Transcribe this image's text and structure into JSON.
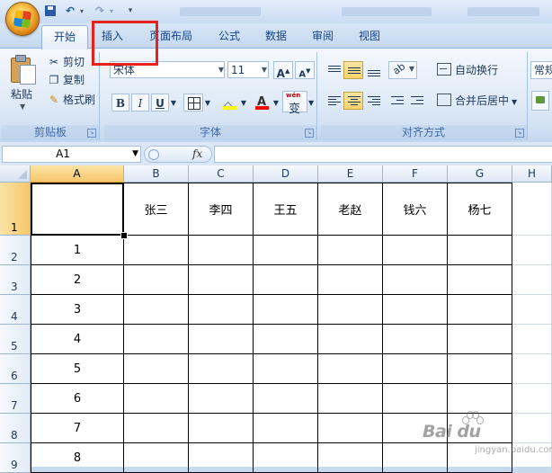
{
  "quick_access": {
    "undo_glyph": "↶",
    "redo_glyph": "↷",
    "dropdown_glyph": "▾",
    "customize_glyph": "▾"
  },
  "tabs": [
    "开始",
    "插入",
    "页面布局",
    "公式",
    "数据",
    "审阅",
    "视图"
  ],
  "ribbon": {
    "clipboard": {
      "paste_label": "粘贴",
      "cut_label": "剪切",
      "copy_label": "复制",
      "format_painter_label": "格式刷",
      "group_label": "剪贴板",
      "icons": {
        "cut": "scissors-icon",
        "copy": "copy-icon",
        "painter": "format-painter-icon"
      }
    },
    "font": {
      "font_name": "宋体",
      "font_size": "11",
      "grow_label": "A",
      "shrink_label": "A",
      "bold": "B",
      "italic": "I",
      "underline": "U",
      "font_color_letter": "A",
      "phonetic_small": "wén",
      "phonetic_char": "变",
      "fill_color": "#ffff00",
      "font_color": "#ff0000",
      "group_label": "字体"
    },
    "alignment": {
      "orientation_glyph": "ab",
      "wrap_text_label": "自动换行",
      "merge_center_label": "合并后居中",
      "group_label": "对齐方式"
    },
    "number": {
      "format_value": "常规"
    }
  },
  "formula_bar": {
    "name_box": "A1",
    "fx_label": "fx",
    "formula": ""
  },
  "sheet": {
    "columns": [
      "A",
      "B",
      "C",
      "D",
      "E",
      "F",
      "G",
      "H"
    ],
    "selected_column": "A",
    "rows": [
      "1",
      "2",
      "3",
      "4",
      "5",
      "6",
      "7",
      "8",
      "9"
    ],
    "header_row": [
      "",
      "张三",
      "李四",
      "王五",
      "老赵",
      "钱六",
      "杨七"
    ],
    "col_a_values": [
      "1",
      "2",
      "3",
      "4",
      "5",
      "6",
      "7",
      "8"
    ]
  },
  "annotation": {
    "highlight_color": "#e8211c"
  },
  "watermark": {
    "brand": "Bai du",
    "sub": "jingyan.baidu.com"
  }
}
